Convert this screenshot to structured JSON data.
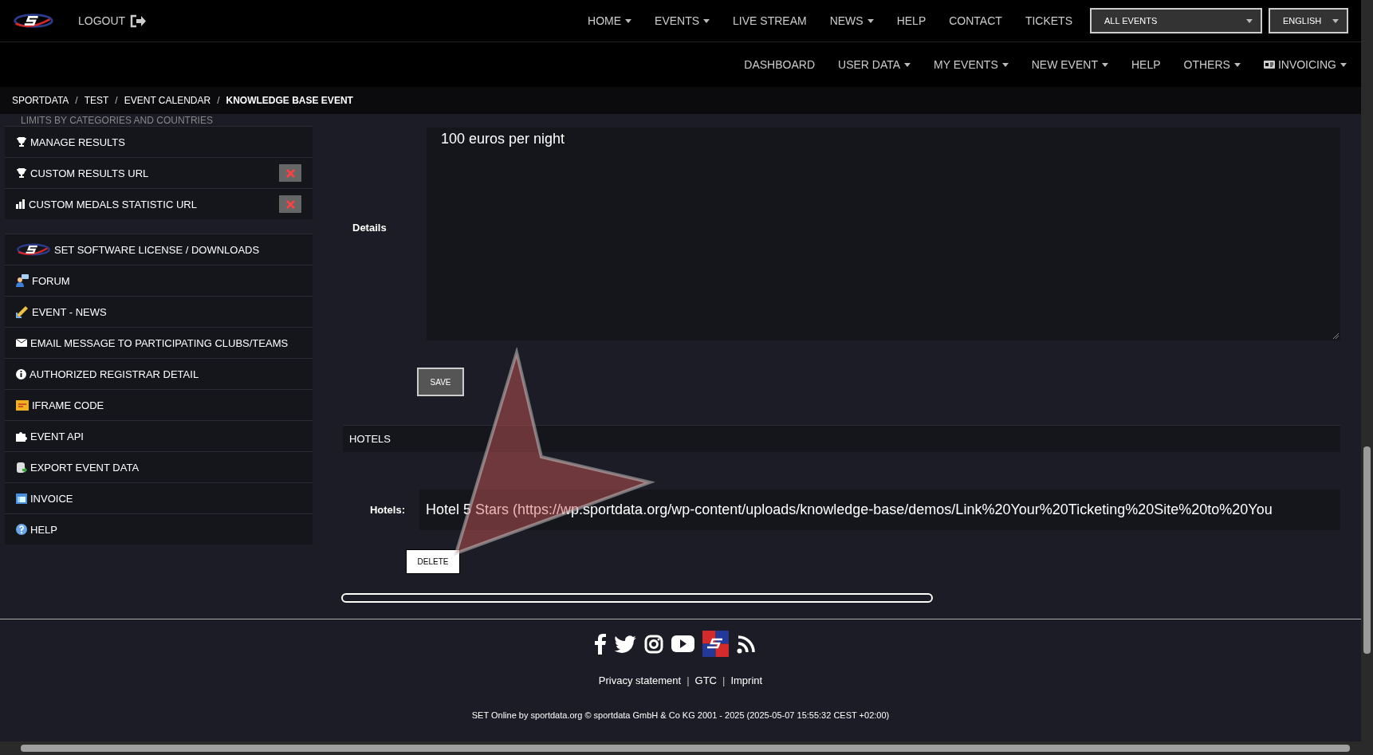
{
  "header": {
    "logout": "LOGOUT",
    "nav": [
      {
        "label": "HOME",
        "dropdown": true
      },
      {
        "label": "EVENTS",
        "dropdown": true
      },
      {
        "label": "LIVE STREAM",
        "dropdown": false
      },
      {
        "label": "NEWS",
        "dropdown": true
      },
      {
        "label": "HELP",
        "dropdown": false
      },
      {
        "label": "CONTACT",
        "dropdown": false
      },
      {
        "label": "TICKETS",
        "dropdown": false
      }
    ],
    "event_select": "ALL EVENTS",
    "language_select": "ENGLISH"
  },
  "subnav": [
    {
      "label": "DASHBOARD",
      "dropdown": false
    },
    {
      "label": "USER DATA",
      "dropdown": true
    },
    {
      "label": "MY EVENTS",
      "dropdown": true
    },
    {
      "label": "NEW EVENT",
      "dropdown": true
    },
    {
      "label": "HELP",
      "dropdown": false
    },
    {
      "label": "OTHERS",
      "dropdown": true
    },
    {
      "label": "INVOICING",
      "dropdown": true
    }
  ],
  "breadcrumb": [
    {
      "kind": "link",
      "text": "SPORTDATA"
    },
    {
      "kind": "separator",
      "text": "/"
    },
    {
      "kind": "link",
      "text": "TEST"
    },
    {
      "kind": "separator",
      "text": "/"
    },
    {
      "kind": "link",
      "text": "EVENT CALENDAR"
    },
    {
      "kind": "separator",
      "text": "/"
    },
    {
      "kind": "current",
      "text": "KNOWLEDGE BASE EVENT"
    }
  ],
  "sidebar": {
    "hidden_item": "LIMITS BY CATEGORIES AND COUNTRIES",
    "groups": [
      [
        {
          "label": "MANAGE RESULTS",
          "removable": false
        },
        {
          "label": "CUSTOM RESULTS URL",
          "removable": true
        },
        {
          "label": "CUSTOM MEDALS STATISTIC URL",
          "removable": true
        }
      ],
      [
        {
          "label": "SET SOFTWARE LICENSE / DOWNLOADS",
          "removable": false
        },
        {
          "label": "FORUM",
          "removable": false
        },
        {
          "label": "EVENT - NEWS",
          "removable": false
        },
        {
          "label": "EMAIL MESSAGE TO PARTICIPATING CLUBS/TEAMS",
          "removable": false
        },
        {
          "label": "AUTHORIZED REGISTRAR DETAIL",
          "removable": false
        },
        {
          "label": "IFRAME CODE",
          "removable": false
        },
        {
          "label": "EVENT API",
          "removable": false
        },
        {
          "label": "EXPORT EVENT DATA",
          "removable": false
        },
        {
          "label": "INVOICE",
          "removable": false
        },
        {
          "label": "HELP",
          "removable": false
        }
      ]
    ]
  },
  "main": {
    "details": {
      "label": "Details",
      "value": "100 euros per night"
    },
    "save_button": "SAVE",
    "hotels_panel": "HOTELS",
    "hotels": {
      "label": "Hotels:",
      "value": "Hotel 5 Stars (https://wp.sportdata.org/wp-content/uploads/knowledge-base/demos/Link%20Your%20Ticketing%20Site%20to%20You"
    },
    "delete_button": "DELETE"
  },
  "footer": {
    "links": [
      {
        "kind": "link",
        "text": "Privacy statement"
      },
      {
        "kind": "separator",
        "text": "|"
      },
      {
        "kind": "link",
        "text": "GTC"
      },
      {
        "kind": "separator",
        "text": "|"
      },
      {
        "kind": "link",
        "text": "Imprint"
      }
    ],
    "copyright": "SET Online by sportdata.org © sportdata GmbH & Co KG 2001 - 2025 (2025-05-07 15:55:32 CEST +02:00)"
  }
}
